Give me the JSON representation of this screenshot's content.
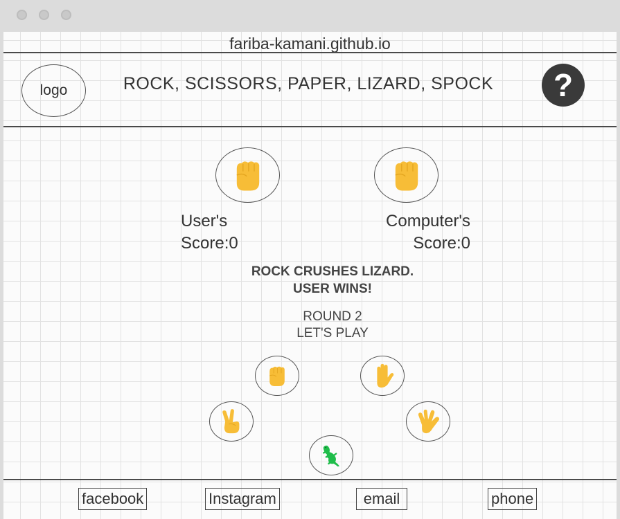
{
  "browser": {
    "url": "fariba-kamani.github.io"
  },
  "header": {
    "logo": "logo",
    "title": "ROCK, SCISSORS, PAPER, LIZARD, SPOCK",
    "help_symbol": "?"
  },
  "game": {
    "user_score_label": "User's",
    "user_score_line": "Score:0",
    "computer_score_label": "Computer's",
    "computer_score_line": "Score:0",
    "result_line1": "ROCK CRUSHES LIZARD.",
    "result_line2": "USER WINS!",
    "round_line1": "ROUND 2",
    "round_line2": "LET'S PLAY",
    "user_choice_icon": "rock-fist-icon",
    "computer_choice_icon": "rock-fist-icon",
    "options": [
      "rock",
      "paper",
      "scissors",
      "spock",
      "lizard"
    ]
  },
  "colors": {
    "hand": "#f7bd37",
    "lizard": "#1fbd4a",
    "rule": "#4a4a4a"
  },
  "footer": {
    "links": [
      "facebook",
      "Instagram",
      "email",
      "phone"
    ]
  }
}
